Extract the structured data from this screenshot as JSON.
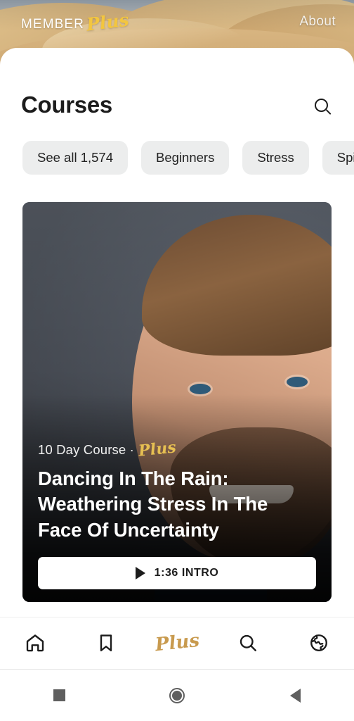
{
  "header": {
    "logo_member": "MEMBER",
    "logo_plus": "Plus",
    "about_label": "About"
  },
  "page": {
    "title": "Courses",
    "search_icon": "search-icon"
  },
  "chips": [
    {
      "label": "See all 1,574"
    },
    {
      "label": "Beginners"
    },
    {
      "label": "Stress"
    },
    {
      "label": "Spiritu"
    }
  ],
  "course_card": {
    "kicker_text": "10 Day Course ·",
    "kicker_badge": "Plus",
    "title": "Dancing In The Rain: Weathering Stress In The Face Of Uncertainty",
    "intro_label": "1:36 INTRO",
    "play_icon": "play-icon"
  },
  "bottom_nav": {
    "items": [
      {
        "name": "home",
        "icon": "home-icon",
        "label": ""
      },
      {
        "name": "bookmarks",
        "icon": "bookmark-icon",
        "label": ""
      },
      {
        "name": "plus",
        "icon": "plus-script",
        "label": "Plus"
      },
      {
        "name": "search",
        "icon": "search-icon",
        "label": ""
      },
      {
        "name": "explore",
        "icon": "globe-icon",
        "label": ""
      }
    ]
  },
  "system_nav": {
    "recents": "recents-square",
    "home": "home-circle",
    "back": "back-triangle"
  },
  "colors": {
    "brand_gold_bright": "#f3c63f",
    "brand_gold_muted": "#c89a4e",
    "chip_bg": "#eceded",
    "text_primary": "#1c1c1c",
    "card_bg": "#4b5059"
  }
}
